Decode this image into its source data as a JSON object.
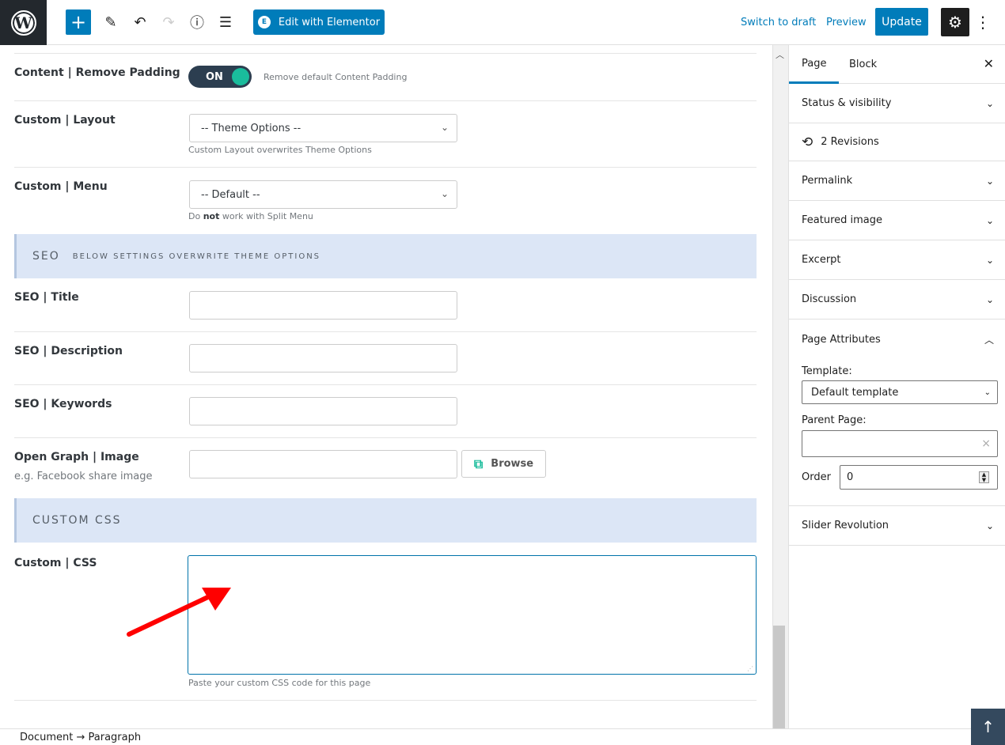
{
  "topbar": {
    "logo": "W",
    "add_icon": "+",
    "tools_icon": "✎",
    "undo_icon": "↶",
    "redo_icon": "↷",
    "info_icon": "ⓘ",
    "outline_icon": "☰",
    "elementor_label": "Edit with Elementor",
    "elementor_icon": "E",
    "switch_to_draft": "Switch to draft",
    "preview": "Preview",
    "update": "Update",
    "settings_icon": "⚙",
    "more_icon": "⋮"
  },
  "content": {
    "remove_padding": {
      "label": "Content | Remove Padding",
      "toggle": "ON",
      "hint": "Remove default Content Padding"
    },
    "layout": {
      "label": "Custom | Layout",
      "value": "-- Theme Options --",
      "hint": "Custom Layout overwrites Theme Options"
    },
    "menu": {
      "label": "Custom | Menu",
      "value": "-- Default --",
      "hint_pre": "Do ",
      "hint_bold": "not",
      "hint_post": " work with Split Menu"
    },
    "seo_section": {
      "title": "SEO",
      "subtitle": "BELOW SETTINGS OVERWRITE THEME OPTIONS"
    },
    "seo_title": {
      "label": "SEO | Title",
      "value": ""
    },
    "seo_description": {
      "label": "SEO | Description",
      "value": ""
    },
    "seo_keywords": {
      "label": "SEO | Keywords",
      "value": ""
    },
    "og_image": {
      "label": "Open Graph | Image",
      "sublabel": "e.g. Facebook share image",
      "value": "",
      "browse": "Browse"
    },
    "css_section": {
      "title": "CUSTOM CSS"
    },
    "custom_css": {
      "label": "Custom | CSS",
      "value": "",
      "hint": "Paste your custom CSS code for this page"
    }
  },
  "sidebar": {
    "tabs": [
      {
        "label": "Page",
        "active": true
      },
      {
        "label": "Block",
        "active": false
      }
    ],
    "close_icon": "✕",
    "panels": {
      "status": "Status & visibility",
      "revisions": "2 Revisions",
      "permalink": "Permalink",
      "featured_image": "Featured image",
      "excerpt": "Excerpt",
      "discussion": "Discussion",
      "page_attributes": "Page Attributes",
      "slider_revolution": "Slider Revolution"
    },
    "page_attributes": {
      "template_label": "Template:",
      "template_value": "Default template",
      "parent_label": "Parent Page:",
      "parent_value": "",
      "clear_icon": "×",
      "order_label": "Order",
      "order_value": "0"
    }
  },
  "footer": {
    "breadcrumb": "Document → Paragraph",
    "to_top_icon": "↑"
  },
  "colors": {
    "accent": "#007cba",
    "toggle_bg": "#2c3e50",
    "toggle_knob": "#1abc9c",
    "section_bg": "#dce6f6",
    "annotation_arrow": "#ff0000"
  }
}
